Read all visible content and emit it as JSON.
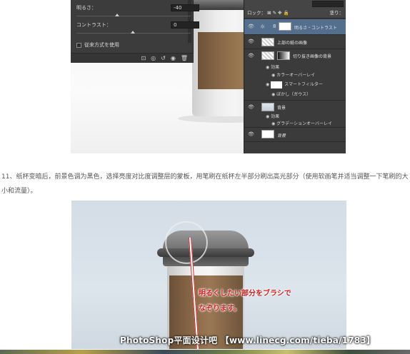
{
  "screenshot1": {
    "properties_panel": {
      "brightness_label": "明るさ：",
      "brightness_value": "-40",
      "contrast_label": "コントラスト：",
      "contrast_value": "0",
      "legacy_label": "従来方式を使用",
      "legacy_checked": false,
      "toolbar_icons": [
        "clip-to-layer-icon",
        "visibility-icon",
        "reset-icon",
        "eye-icon",
        "trash-icon"
      ]
    },
    "layers_panel": {
      "lock_label": "ロック：",
      "fill_label": "塗り：",
      "layers": [
        {
          "name": "明るさ・コントラスト",
          "type": "adjustment",
          "selected": true
        },
        {
          "name": "上部の紙の画像",
          "type": "image"
        },
        {
          "name": "切り抜き画像の背景",
          "type": "smart-object",
          "effects_label": "効果",
          "effects": [
            "カラーオーバーレイ"
          ],
          "filters_label": "スマートフィルター",
          "filters": [
            "ぼかし（ガウス）"
          ]
        },
        {
          "name": "背景",
          "type": "fill",
          "effects_label": "効果",
          "effects": [
            "グラデーションオーバーレイ"
          ]
        },
        {
          "name": "背景",
          "type": "background"
        }
      ]
    }
  },
  "step_text": "11、纸杯变暗后，前景色调为黑色，选择亮度对比度调整层的蒙板，用笔刷在纸杯左半部分刷出高光部分（使用软画笔并适当调整一下笔刷的大小和流量）。",
  "screenshot2": {
    "callout_line1": "明るくしたい部分をブラシで",
    "callout_line2": "なぞります。"
  },
  "watermark": "PhotoShop平面设计吧 【www.linecg.com/tieba/1783】",
  "colors": {
    "panel_bg": "#3c3c3c",
    "callout": "#d21f1f",
    "step_text": "#555555"
  }
}
